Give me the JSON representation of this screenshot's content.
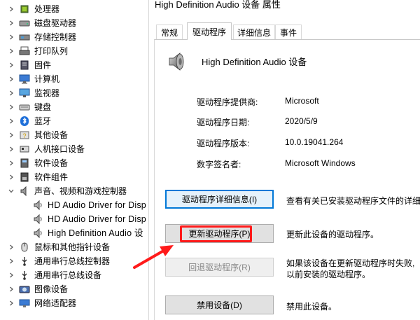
{
  "tree": {
    "items": [
      {
        "label": "处理器",
        "icon": "processor-icon",
        "expanded": false
      },
      {
        "label": "磁盘驱动器",
        "icon": "disk-drive-icon",
        "expanded": false
      },
      {
        "label": "存储控制器",
        "icon": "storage-controller-icon",
        "expanded": false
      },
      {
        "label": "打印队列",
        "icon": "printer-icon",
        "expanded": false
      },
      {
        "label": "固件",
        "icon": "firmware-icon",
        "expanded": false
      },
      {
        "label": "计算机",
        "icon": "computer-icon",
        "expanded": false
      },
      {
        "label": "监视器",
        "icon": "monitor-icon",
        "expanded": false
      },
      {
        "label": "键盘",
        "icon": "keyboard-icon",
        "expanded": false
      },
      {
        "label": "蓝牙",
        "icon": "bluetooth-icon",
        "expanded": false
      },
      {
        "label": "其他设备",
        "icon": "other-device-icon",
        "expanded": false
      },
      {
        "label": "人机接口设备",
        "icon": "hid-icon",
        "expanded": false
      },
      {
        "label": "软件设备",
        "icon": "software-device-icon",
        "expanded": false
      },
      {
        "label": "软件组件",
        "icon": "software-component-icon",
        "expanded": false
      },
      {
        "label": "声音、视频和游戏控制器",
        "icon": "sound-icon",
        "expanded": true
      },
      {
        "label": "HD Audio Driver for Disp",
        "icon": "speaker-icon",
        "child": true
      },
      {
        "label": "HD Audio Driver for Disp",
        "icon": "speaker-icon",
        "child": true
      },
      {
        "label": "High Definition Audio 设",
        "icon": "speaker-icon",
        "child": true
      },
      {
        "label": "鼠标和其他指针设备",
        "icon": "mouse-icon",
        "expanded": false
      },
      {
        "label": "通用串行总线控制器",
        "icon": "usb-icon",
        "expanded": false
      },
      {
        "label": "通用串行总线设备",
        "icon": "usb-icon",
        "expanded": false
      },
      {
        "label": "图像设备",
        "icon": "camera-icon",
        "expanded": false
      },
      {
        "label": "网络适配器",
        "icon": "network-icon",
        "expanded": false
      }
    ]
  },
  "dialog": {
    "title": "High Definition Audio 设备 属性",
    "tabs": [
      "常规",
      "驱动程序",
      "详细信息",
      "事件"
    ],
    "active_tab": "驱动程序",
    "device_name": "High Definition Audio 设备",
    "info": [
      {
        "label": "驱动程序提供商:",
        "value": "Microsoft"
      },
      {
        "label": "驱动程序日期:",
        "value": "2020/5/9"
      },
      {
        "label": "驱动程序版本:",
        "value": "10.0.19041.264"
      },
      {
        "label": "数字签名者:",
        "value": "Microsoft Windows"
      }
    ],
    "buttons": [
      {
        "label": "驱动程序详细信息(I)",
        "desc": [
          "查看有关已安装驱动程序文件的详细"
        ],
        "state": "focused"
      },
      {
        "label": "更新驱动程序(P)",
        "desc": [
          "更新此设备的驱动程序。"
        ],
        "state": "normal"
      },
      {
        "label": "回退驱动程序(R)",
        "desc": [
          "如果该设备在更新驱动程序时失败,",
          "以前安装的驱动程序。"
        ],
        "state": "disabled"
      },
      {
        "label": "禁用设备(D)",
        "desc": [
          "禁用此设备。"
        ],
        "state": "normal"
      }
    ]
  },
  "colors": {
    "highlight": "#ff1a1a",
    "focus_border": "#0078d7"
  }
}
